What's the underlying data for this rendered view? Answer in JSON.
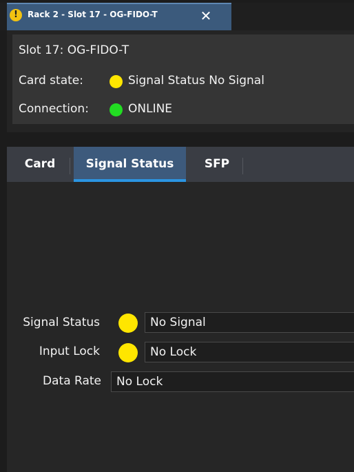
{
  "window": {
    "tab_title": "Rack 2 - Slot 17 - OG-FIDO-T",
    "warning_icon": "!",
    "close_icon": "✕"
  },
  "header": {
    "slot_label": "Slot 17: OG-FIDO-T",
    "card_state_label": "Card state:",
    "card_state_value": "Signal Status No Signal",
    "connection_label": "Connection:",
    "connection_value": "ONLINE"
  },
  "tabs": [
    {
      "label": "Card",
      "active": false
    },
    {
      "label": "Signal Status",
      "active": true
    },
    {
      "label": "SFP",
      "active": false
    }
  ],
  "signal_status": {
    "signal_status_label": "Signal Status",
    "signal_status_value": "No Signal",
    "input_lock_label": "Input Lock",
    "input_lock_value": "No Lock",
    "data_rate_label": "Data Rate",
    "data_rate_value": "No Lock"
  },
  "colors": {
    "status_yellow": "#ffe600",
    "online_green": "#22dd22",
    "accent_blue": "#2b95e2",
    "active_tab": "#3d5a7c"
  }
}
